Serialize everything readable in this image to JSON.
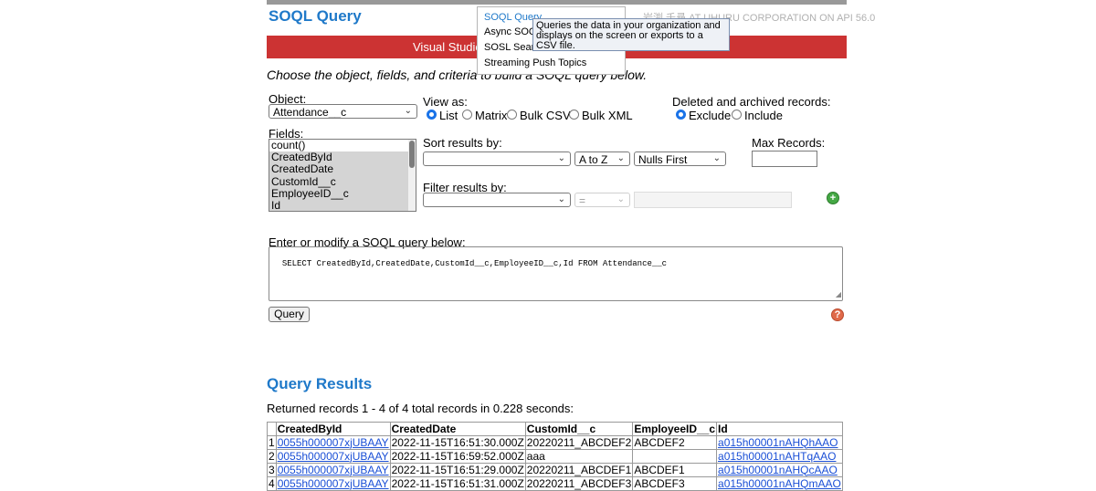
{
  "app": {
    "title": "SOQL Query",
    "user_info": "岩渕 千尋 AT UHURU CORPORATION ON API 56.0",
    "nav_label": "Visual Studio"
  },
  "menu": {
    "items": [
      {
        "label": "SOQL Query",
        "active": true
      },
      {
        "label": "Async SOQ"
      },
      {
        "label": "SOSL Searc"
      },
      {
        "label": "Streaming Push Topics"
      }
    ],
    "tooltip": "Queries the data in your organization and displays on the screen or exports to a CSV file."
  },
  "instructions": "Choose the object, fields, and criteria to build a SOQL query below.",
  "object": {
    "label": "Object:",
    "value": "Attendance__c"
  },
  "view_as": {
    "label": "View as:",
    "options": [
      "List",
      "Matrix",
      "Bulk CSV",
      "Bulk XML"
    ],
    "selected": "List"
  },
  "deleted": {
    "label": "Deleted and archived records:",
    "options": [
      "Exclude",
      "Include"
    ],
    "selected": "Exclude"
  },
  "fields": {
    "label": "Fields:",
    "options": [
      "count()",
      "CreatedById",
      "CreatedDate",
      "CustomId__c",
      "EmployeeID__c",
      "Id"
    ],
    "selected": [
      "CreatedById",
      "CreatedDate",
      "CustomId__c",
      "EmployeeID__c",
      "Id"
    ]
  },
  "sort": {
    "label": "Sort results by:",
    "field": "",
    "direction": "A to Z",
    "nulls": "Nulls First"
  },
  "max_records": {
    "label": "Max Records:",
    "value": ""
  },
  "filter": {
    "label": "Filter results by:",
    "field": "",
    "operator": "=",
    "value": ""
  },
  "query": {
    "label": "Enter or modify a SOQL query below:",
    "text": "SELECT CreatedById,CreatedDate,CustomId__c,EmployeeID__c,Id FROM Attendance__c",
    "button": "Query"
  },
  "results": {
    "title": "Query Results",
    "summary": "Returned records 1 - 4 of 4 total records in 0.228 seconds:",
    "columns": [
      "CreatedById",
      "CreatedDate",
      "CustomId__c",
      "EmployeeID__c",
      "Id"
    ],
    "rows": [
      [
        "1",
        "0055h000007xjUBAAY",
        "2022-11-15T16:51:30.000Z",
        "20220211_ABCDEF2",
        "ABCDEF2",
        "a015h00001nAHQhAAO"
      ],
      [
        "2",
        "0055h000007xjUBAAY",
        "2022-11-15T16:59:52.000Z",
        "aaa",
        "",
        "a015h00001nAHTqAAO"
      ],
      [
        "3",
        "0055h000007xjUBAAY",
        "2022-11-15T16:51:29.000Z",
        "20220211_ABCDEF1",
        "ABCDEF1",
        "a015h00001nAHQcAAO"
      ],
      [
        "4",
        "0055h000007xjUBAAY",
        "2022-11-15T16:51:31.000Z",
        "20220211_ABCDEF3",
        "ABCDEF3",
        "a015h00001nAHQmAAO"
      ]
    ]
  },
  "colors": {
    "accent": "#1f79c9",
    "nav_bar": "#cc3333",
    "link": "#1a4fd6"
  }
}
